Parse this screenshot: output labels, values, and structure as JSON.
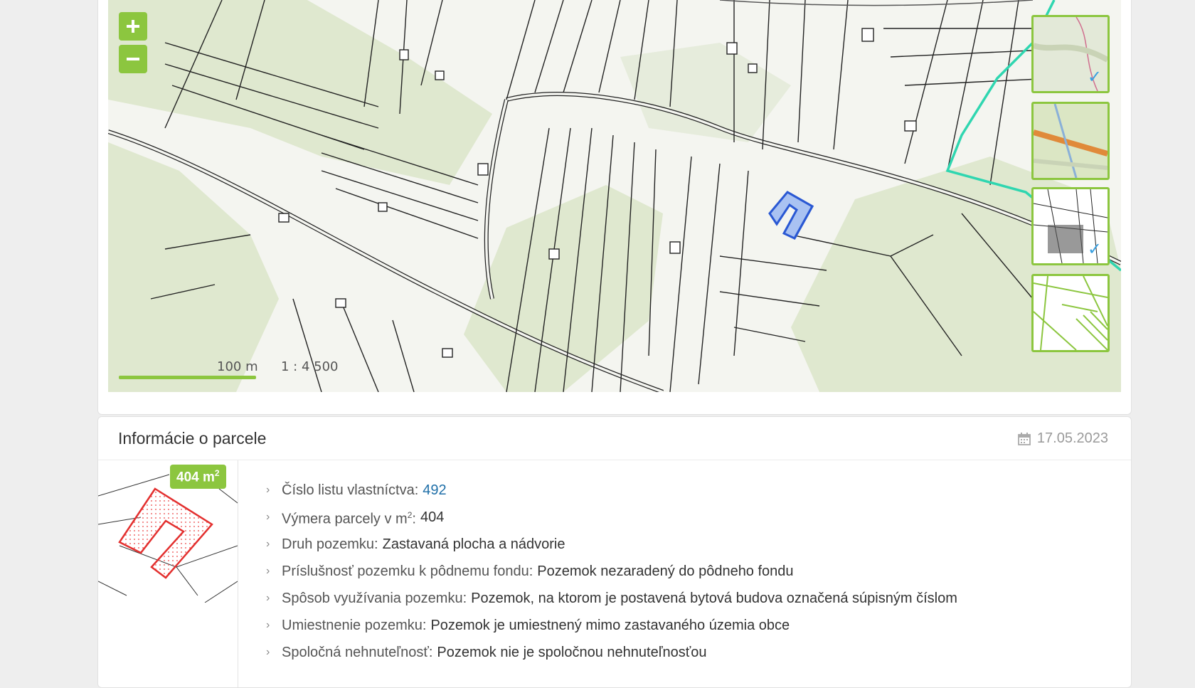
{
  "map": {
    "zoom_in_label": "+",
    "zoom_out_label": "−",
    "scale_label": "100 m",
    "scale_ratio": "1 : 4 500",
    "layers": [
      {
        "name": "layer-terrain",
        "selected": true
      },
      {
        "name": "layer-topographic",
        "selected": false
      },
      {
        "name": "layer-cadastral",
        "selected": true
      },
      {
        "name": "layer-green-parcels",
        "selected": false
      }
    ],
    "colors": {
      "accent": "#8cc63f",
      "parcel": "#3b66d9",
      "boundary": "#2fd6b0"
    }
  },
  "info": {
    "title": "Informácie o parcele",
    "date": "17.05.2023",
    "area_badge_value": "404 m",
    "area_badge_sup": "2",
    "properties": [
      {
        "label": "Číslo listu vlastníctva:",
        "value": "492",
        "link": true
      },
      {
        "label_pre": "Výmera parcely v m",
        "label_sup": "2",
        "label_post": ":",
        "value": "404"
      },
      {
        "label": "Druh pozemku:",
        "value": "Zastavaná plocha a nádvorie"
      },
      {
        "label": "Príslušnosť pozemku k pôdnemu fondu:",
        "value": "Pozemok nezaradený do pôdneho fondu"
      },
      {
        "label": "Spôsob využívania pozemku:",
        "value": "Pozemok, na ktorom je postavená bytová budova označená súpisným číslom"
      },
      {
        "label": "Umiestnenie pozemku:",
        "value": "Pozemok je umiestnený mimo zastavaného územia obce"
      },
      {
        "label": "Spoločná nehnuteľnosť:",
        "value": "Pozemok nie je spoločnou nehnuteľnosťou"
      }
    ]
  }
}
